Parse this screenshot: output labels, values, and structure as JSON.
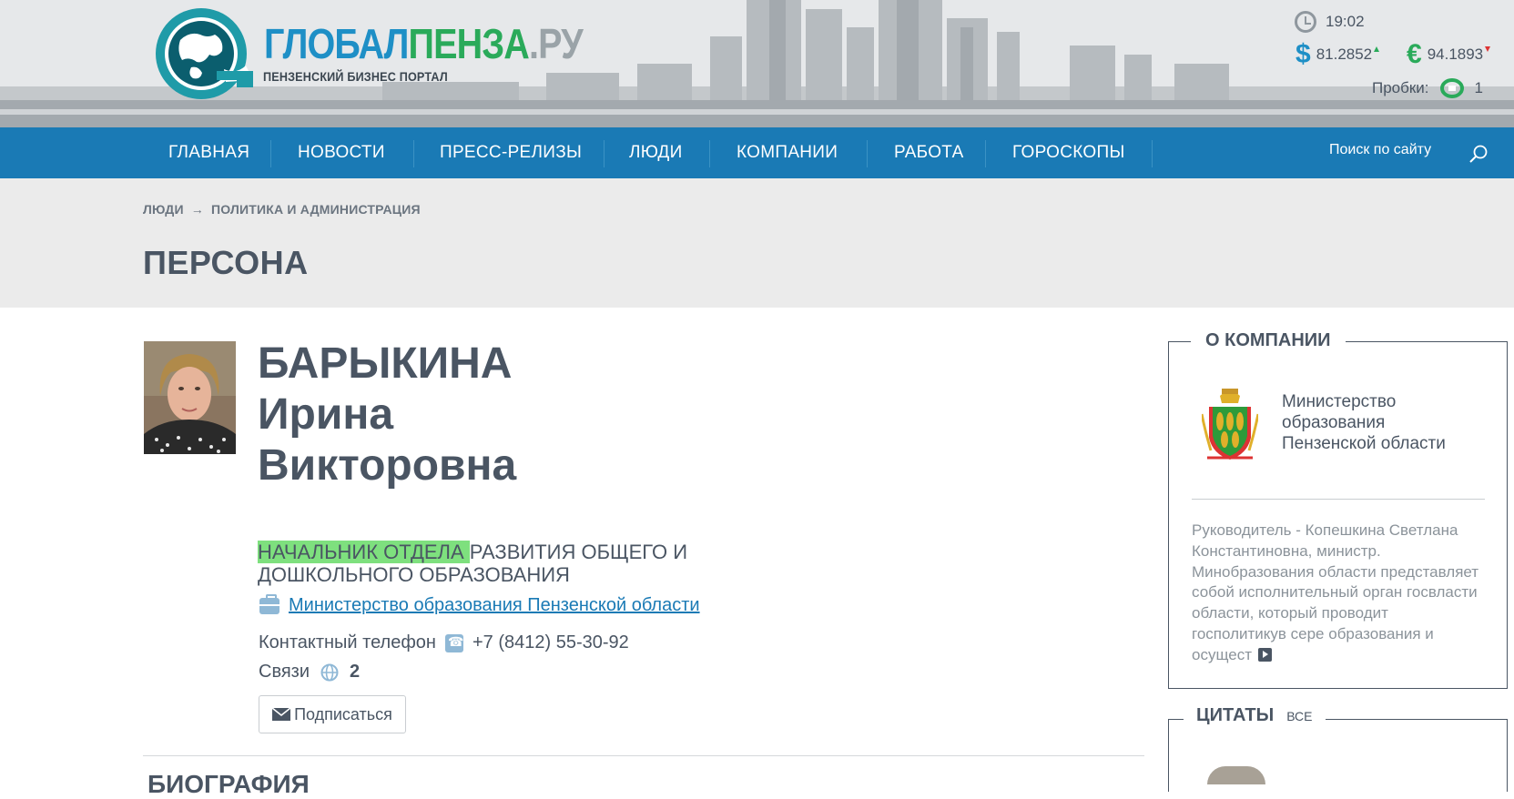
{
  "header": {
    "logo_part1": "ГЛОБАЛ",
    "logo_part2": "ПЕНЗА",
    "logo_part3": ".РУ",
    "logo_subtitle": "ПЕНЗЕНСКИЙ БИЗНЕС ПОРТАЛ",
    "time": "19:02",
    "usd_symbol": "$",
    "usd_rate": "81.2852",
    "eur_symbol": "€",
    "eur_rate": "94.1893",
    "traffic_label": "Пробки:",
    "traffic_level": "1",
    "colors": {
      "brand_blue": "#1e8fc6",
      "brand_green": "#2aaa5a",
      "usd_trend": "up",
      "eur_trend": "down"
    }
  },
  "nav": {
    "items": [
      {
        "label": "ГЛАВНАЯ"
      },
      {
        "label": "НОВОСТИ"
      },
      {
        "label": "ПРЕСС-РЕЛИЗЫ"
      },
      {
        "label": "ЛЮДИ"
      },
      {
        "label": "КОМПАНИИ"
      },
      {
        "label": "РАБОТА"
      },
      {
        "label": "ГОРОСКОПЫ"
      }
    ],
    "search_label": "Поиск по сайту",
    "background": "#1a7ab5"
  },
  "breadcrumb": {
    "items": [
      "ЛЮДИ",
      "ПОЛИТИКА И АДМИНИСТРАЦИЯ"
    ],
    "separator": "→"
  },
  "page_title": "ПЕРСОНА",
  "person": {
    "last_name": "БАРЫКИНА",
    "first_name": "Ирина",
    "patronymic": "Викторовна",
    "position_highlight": "НАЧАЛЬНИК ОТДЕЛА ",
    "position_rest": "РАЗВИТИЯ ОБЩЕГО И ДОШКОЛЬНОГО ОБРАЗОВАНИЯ",
    "company_link": "Министерство образования Пензенской области",
    "phone_label": "Контактный телефон",
    "phone": "+7 (8412) 55-30-92",
    "links_label": "Связи",
    "links_count": "2",
    "subscribe_label": "Подписаться"
  },
  "biography_title": "БИОГРАФИЯ",
  "sidebar": {
    "about_title": "О КОМПАНИИ",
    "ministry_name": "Министерство образования Пензенской области",
    "description": "Руководитель - Копешкина Светлана Константиновна, министр. Минобразования области представляет собой исполнительный орган госвласти области, который проводит госполитикув сере образования и осущест",
    "quotes_title": "ЦИТАТЫ",
    "quotes_all": "ВСЕ"
  }
}
